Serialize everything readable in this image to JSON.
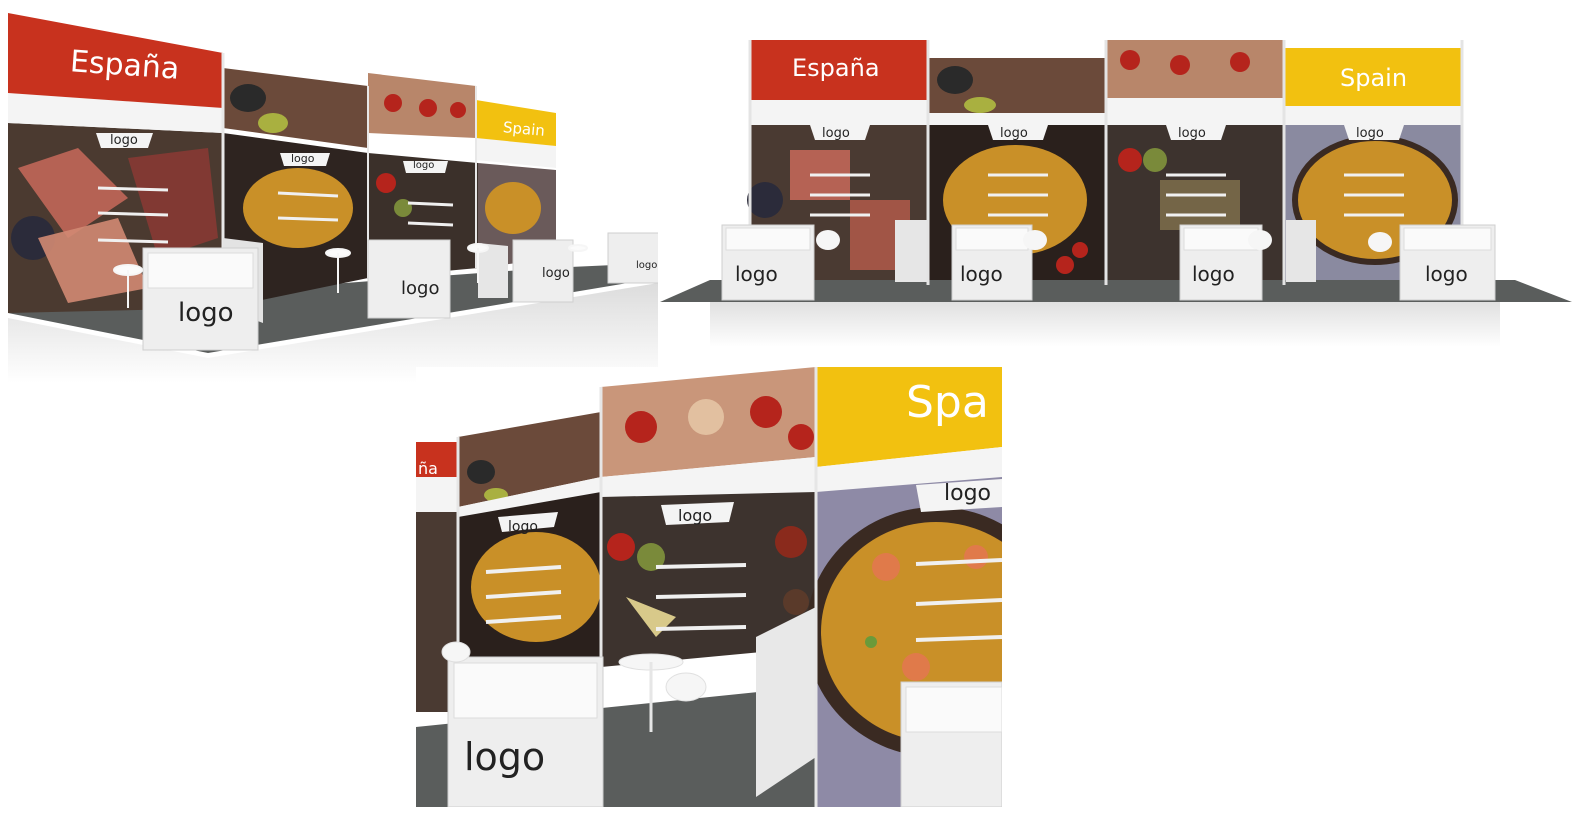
{
  "views": [
    {
      "id": "perspective-left",
      "header_left": "España",
      "header_right": "Spain",
      "logo": "logo"
    },
    {
      "id": "front-elevation",
      "header_left": "España",
      "header_right": "Spain",
      "logo": "logo"
    },
    {
      "id": "close-up",
      "header_left_fragment": "ña",
      "header_right_fragment": "Spa",
      "logo": "logo"
    }
  ],
  "colors": {
    "red_banner": "#c8321e",
    "yellow_banner": "#f2c110",
    "frame_white": "#f4f4f4",
    "floor_grey": "#5a5d5c",
    "food_dark": "#3a2a22",
    "paella_gold": "#c99028",
    "tomato_red": "#b5241c"
  }
}
